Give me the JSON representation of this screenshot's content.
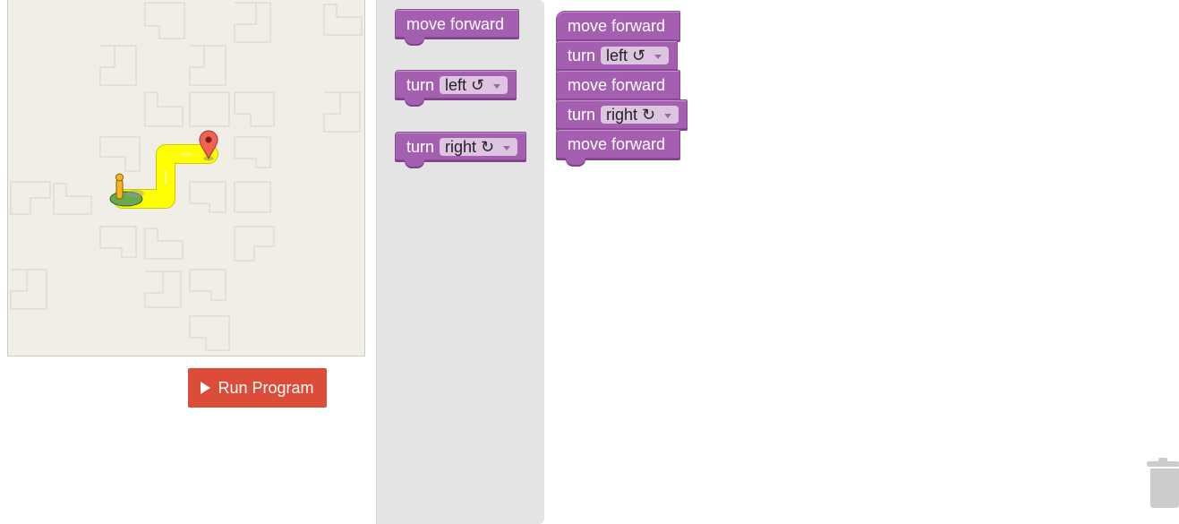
{
  "run_button": {
    "label": "Run Program",
    "icon": "play-icon"
  },
  "toolbox": {
    "blocks": [
      {
        "keyword": "move forward"
      },
      {
        "keyword": "turn",
        "option": "left ↺"
      },
      {
        "keyword": "turn",
        "option": "right ↻"
      }
    ]
  },
  "workspace": {
    "blocks": [
      {
        "keyword": "move forward"
      },
      {
        "keyword": "turn",
        "option": "left ↺"
      },
      {
        "keyword": "move forward"
      },
      {
        "keyword": "turn",
        "option": "right ↻"
      },
      {
        "keyword": "move forward"
      }
    ]
  },
  "colors": {
    "block": "#a55fb1",
    "path": "#ffff00",
    "run_button": "#dd4b39",
    "maze_bg": "#f1eee7"
  },
  "icons": {
    "start_marker": "pegman-icon",
    "goal_marker": "map-pin-icon",
    "trash": "trash-icon"
  }
}
